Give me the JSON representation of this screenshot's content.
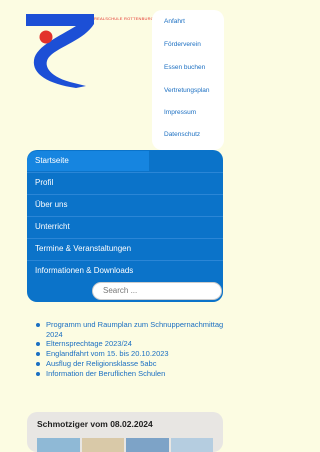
{
  "header": {
    "school_name": "REALSCHULE ROTTENBURG"
  },
  "top_menu": {
    "items": [
      {
        "label": "Anfahrt"
      },
      {
        "label": "Förderverein"
      },
      {
        "label": "Essen buchen"
      },
      {
        "label": "Vertretungsplan"
      },
      {
        "label": "Impressum"
      },
      {
        "label": "Datenschutz"
      }
    ]
  },
  "main_nav": {
    "items": [
      {
        "label": "Startseite"
      },
      {
        "label": "Profil"
      },
      {
        "label": "Über uns"
      },
      {
        "label": "Unterricht"
      },
      {
        "label": "Termine & Veranstaltungen"
      },
      {
        "label": "Informationen & Downloads"
      }
    ]
  },
  "search": {
    "placeholder": "Search ..."
  },
  "news": {
    "items": [
      {
        "label": "Programm und Raumplan zum Schnuppernachmittag 2024"
      },
      {
        "label": "Elternsprechtage 2023/24"
      },
      {
        "label": "Englandfahrt vom 15. bis 20.10.2023"
      },
      {
        "label": "Ausflug der Religionsklasse 5abc"
      },
      {
        "label": "Information der Beruflichen Schulen"
      }
    ]
  },
  "article": {
    "title": "Schmotziger vom 08.02.2024"
  },
  "colors": {
    "background": "#fcfce2",
    "nav_blue": "#0b73c9",
    "active_blue": "#1685e0",
    "link_blue": "#1b6fc2",
    "logo_red": "#e3322b",
    "logo_blue": "#1c4fd6"
  }
}
